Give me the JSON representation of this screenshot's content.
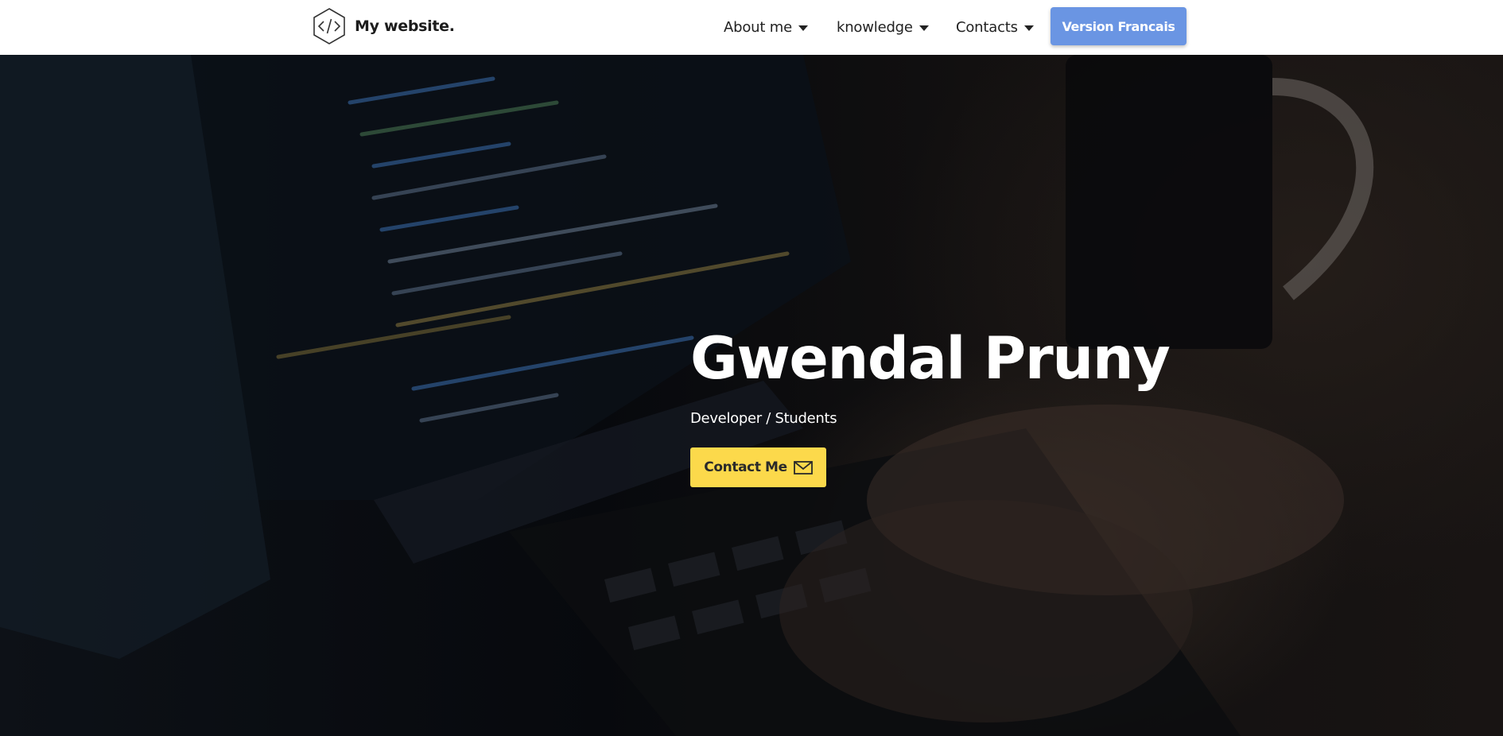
{
  "header": {
    "brand": {
      "logo_icon": "code-hexagon-icon",
      "name": "My website."
    },
    "nav": [
      {
        "label": "About me",
        "icon": "caret-down-icon"
      },
      {
        "label": "knowledge",
        "icon": "caret-down-icon"
      },
      {
        "label": "Contacts",
        "icon": "caret-down-icon"
      }
    ],
    "language_button": "Version Francais"
  },
  "hero": {
    "background": "photo of a laptop screen showing code with hands typing and a mug",
    "title": "Gwendal Pruny",
    "subtitle": "Developer / Students",
    "contact_button": {
      "label": "Contact Me",
      "icon": "envelope-icon"
    }
  },
  "colors": {
    "header_bg": "#ffffff",
    "language_button_bg": "#6a95e3",
    "contact_button_bg": "#fcd94b",
    "hero_text": "#ffffff"
  }
}
